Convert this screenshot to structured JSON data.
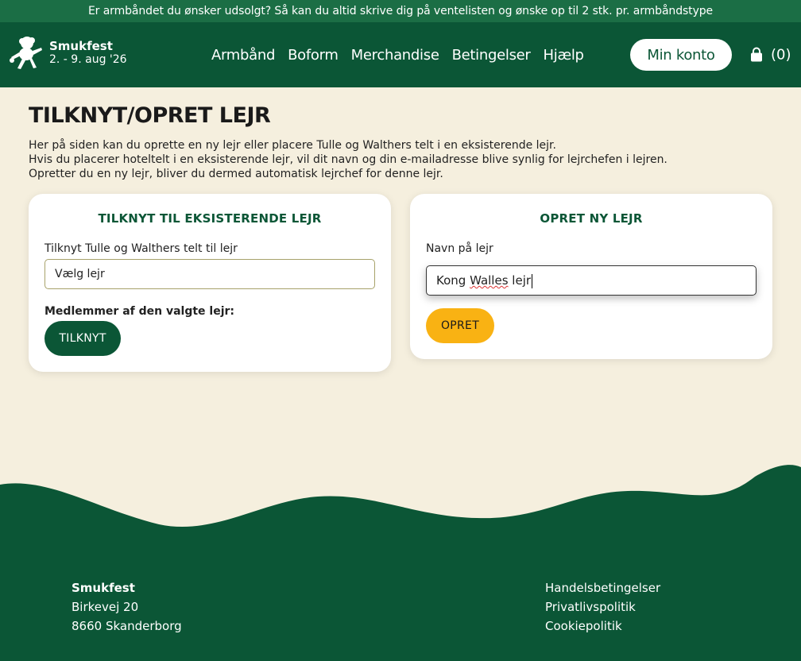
{
  "banner": {
    "text": "Er armbåndet du ønsker udsolgt? Så kan du altid skrive dig på ventelisten og ønske op til 2 stk. pr. armbåndstype"
  },
  "header": {
    "logo_name": "Smukfest",
    "logo_date": "2. - 9. aug '26",
    "nav": [
      "Armbånd",
      "Boform",
      "Merchandise",
      "Betingelser",
      "Hjælp"
    ],
    "account_label": "Min konto",
    "cart_count": "(0)",
    "cart_icon": "shopping-bag-icon"
  },
  "page": {
    "title": "TILKNYT/OPRET LEJR",
    "intro": [
      "Her på siden kan du oprette en ny lejr eller placere Tulle og Walthers telt i en eksisterende lejr.",
      "Hvis du placerer hoteltelt i en eksisterende lejr, vil dit navn og din e-mailadresse blive synlig for lejrchefen i lejren.",
      "Opretter du en ny lejr, bliver du dermed automatisk lejrchef for denne lejr."
    ]
  },
  "join_card": {
    "title": "TILKNYT TIL EKSISTERENDE LEJR",
    "label": "Tilknyt Tulle og Walthers telt til lejr",
    "select_value": "Vælg lejr",
    "members_label": "Medlemmer af den valgte lejr:",
    "button_label": "TILKNYT"
  },
  "create_card": {
    "title": "OPRET NY LEJR",
    "label": "Navn på lejr",
    "input_value_a": "Kong ",
    "input_value_b": "Walles",
    "input_value_c": " lejr",
    "button_label": "OPRET"
  },
  "footer": {
    "name": "Smukfest",
    "street": "Birkevej 20",
    "city": "8660 Skanderborg",
    "links": [
      "Handelsbetingelser",
      "Privatlivspolitik",
      "Cookiepolitik"
    ]
  },
  "colors": {
    "dark_green": "#0b5636",
    "banner_green": "#1b6e45",
    "yellow": "#f9b213",
    "background": "#f5efde"
  }
}
